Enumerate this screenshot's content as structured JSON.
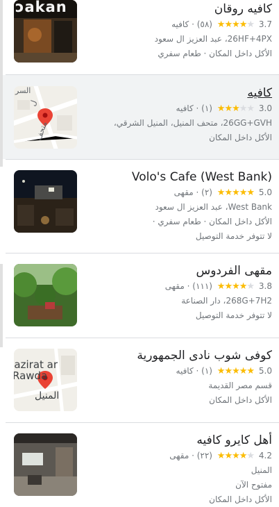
{
  "colors": {
    "star": "#fbbc04",
    "star_empty": "#dadce0",
    "pin": "#ea4335"
  },
  "places": [
    {
      "name": "كافيه روقان",
      "rating": "3.7",
      "stars": 4,
      "reviews": "(٥٨)",
      "category": "كافيه",
      "address": "26HF+4PX، عبد العزيز ال سعود",
      "features": "الأكل داخل المكان · طعام سفري",
      "thumb_text": "ɔakan",
      "thumb_icon": "storefront-photo"
    },
    {
      "name": "كافيه",
      "rating": "3.0",
      "stars": 3,
      "reviews": "(١)",
      "category": "كافيه",
      "address": "26GG+GVH، متحف المنيل، المنيل الشرقي،",
      "features": "الأكل داخل المكان",
      "map_labels": [
        "السر",
        "متحف",
        "ل"
      ],
      "thumb_icon": "map-pin-icon"
    },
    {
      "name": "Volo's Cafe (West Bank)",
      "rating": "5.0",
      "stars": 5,
      "reviews": "(٢)",
      "category": "مقهى",
      "address": "West Bank، عبد العزيز ال سعود",
      "features": "الأكل داخل المكان · طعام سفري ·",
      "extra": "لا تتوفر خدمة التوصيل",
      "thumb_icon": "night-terrace-photo"
    },
    {
      "name": "مقهى الفردوس",
      "rating": "3.8",
      "stars": 4,
      "reviews": "(١١١)",
      "category": "مقهى",
      "address": "268G+7H2، دار الصناعة",
      "features": "لا تتوفر خدمة التوصيل",
      "thumb_icon": "garden-cafe-photo"
    },
    {
      "name": "كوفى شوب نادى الجمهورية",
      "rating": "5.0",
      "stars": 5,
      "reviews": "(١)",
      "category": "كافيه",
      "address": "قسم مصر القديمة",
      "features": "الأكل داخل المكان",
      "map_labels": [
        "Jazirat ar",
        "Rawda",
        "المنيل"
      ],
      "thumb_icon": "map-pin-icon"
    },
    {
      "name": "أهل كايرو كافيه",
      "rating": "4.2",
      "stars": 4,
      "reviews": "(٢٢)",
      "category": "مقهى",
      "address": "المنيل",
      "features": "مفتوح الآن",
      "extra": "الأكل داخل المكان",
      "thumb_icon": "interior-photo"
    }
  ]
}
